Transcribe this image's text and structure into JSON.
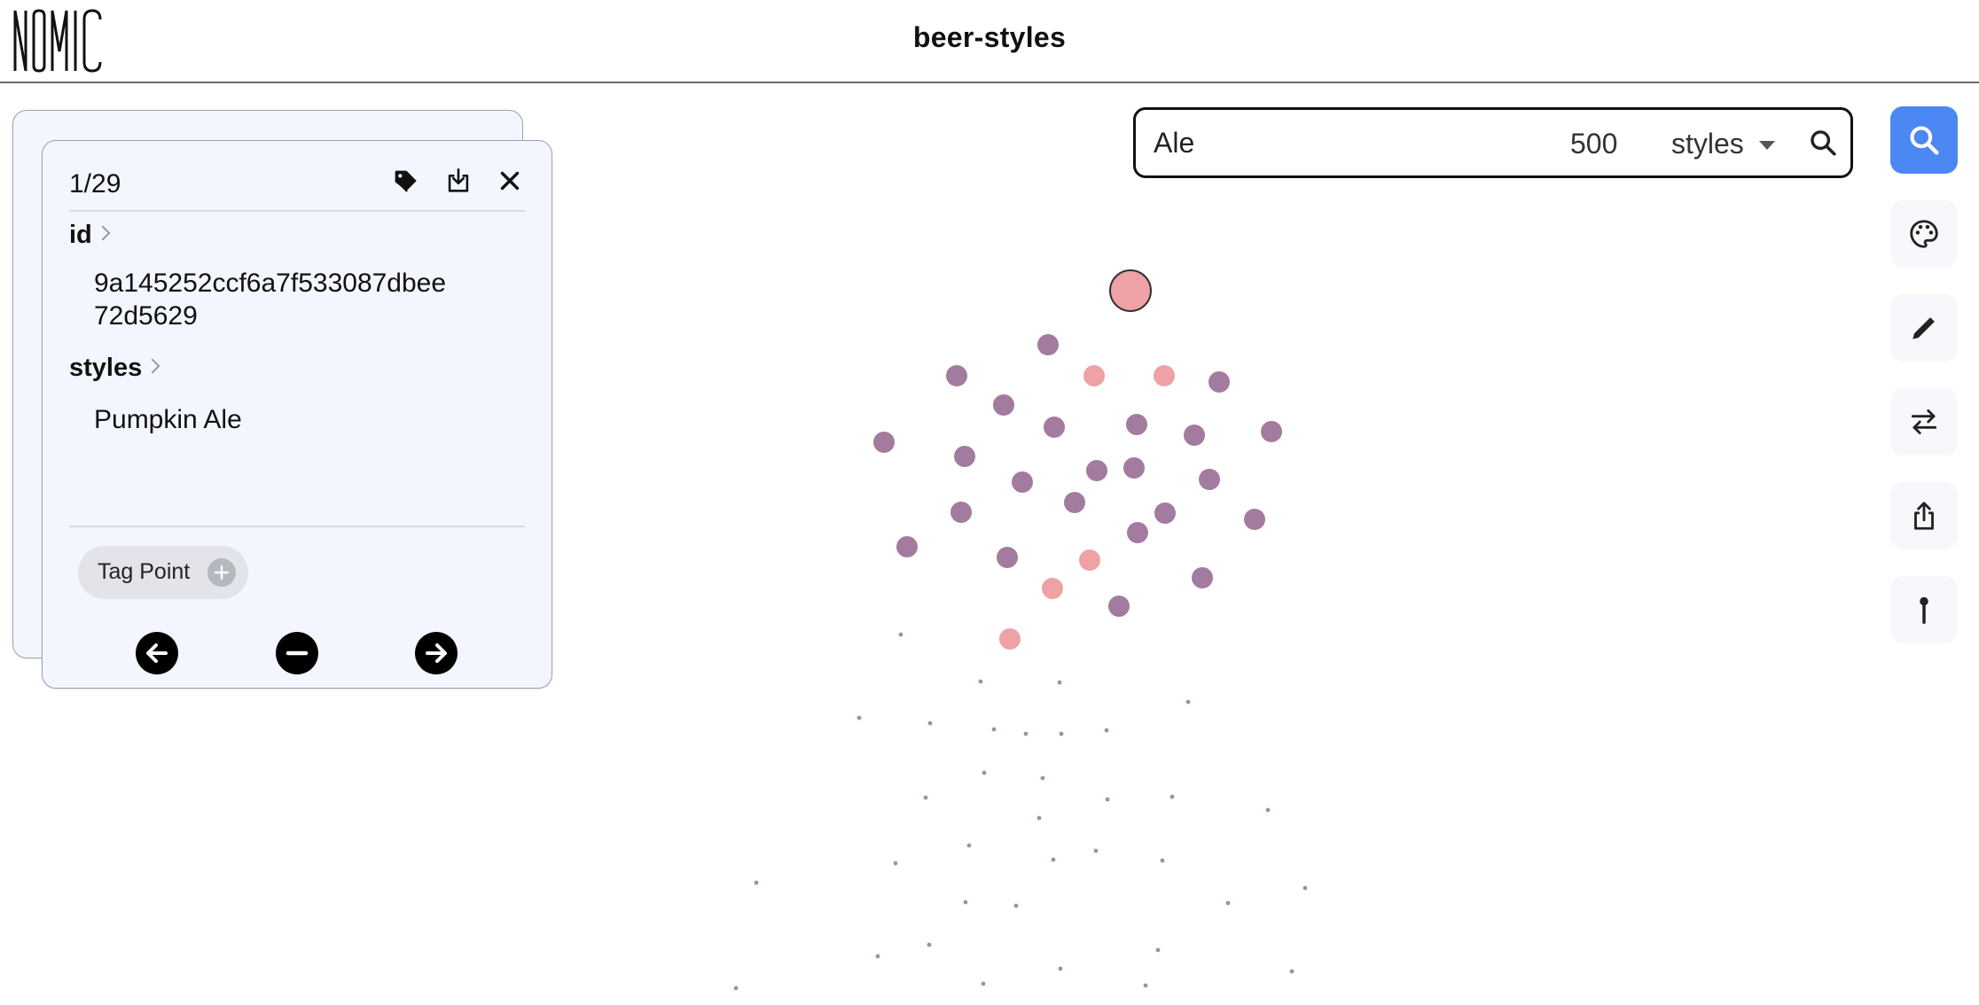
{
  "header": {
    "title": "beer-styles",
    "logo_text": "NOMIC"
  },
  "search": {
    "query": "Ale",
    "count": "500",
    "field": "styles"
  },
  "toolbar": {
    "tools": [
      "search-icon",
      "palette-icon",
      "pencil-icon",
      "swap-icon",
      "share-icon",
      "pin-icon"
    ],
    "active": "search-icon",
    "active_color": "#4c88f4"
  },
  "panel": {
    "pager": "1/29",
    "fields": [
      {
        "label": "id",
        "value": "9a145252ccf6a7f533087dbee\n72d5629"
      },
      {
        "label": "styles",
        "value": "Pumpkin Ale"
      }
    ],
    "tag_button": "Tag Point"
  },
  "map": {
    "colors": {
      "purple": "#a37b9f",
      "pink": "#eea2a5",
      "selected": "#eea2a5"
    }
  }
}
